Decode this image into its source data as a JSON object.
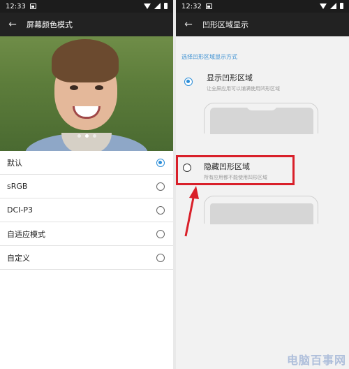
{
  "left": {
    "status": {
      "time": "12:33"
    },
    "appbar": {
      "back": "←",
      "title": "屏幕颜色模式"
    },
    "photo": {
      "slides": 3,
      "active_slide": 1
    },
    "options": [
      {
        "label": "默认",
        "checked": true
      },
      {
        "label": "sRGB",
        "checked": false
      },
      {
        "label": "DCI-P3",
        "checked": false
      },
      {
        "label": "自适应模式",
        "checked": false
      },
      {
        "label": "自定义",
        "checked": false
      }
    ]
  },
  "right": {
    "status": {
      "time": "12:32"
    },
    "appbar": {
      "back": "←",
      "title": "凹形区域显示"
    },
    "section_label": "选择凹形区域显示方式",
    "option_show": {
      "title": "显示凹形区域",
      "desc": "让全屏应用可以铺满使用凹形区域",
      "checked": true
    },
    "option_hide": {
      "title": "隐藏凹形区域",
      "desc": "所有应用都不能使用凹形区域",
      "checked": false
    }
  },
  "colors": {
    "accent": "#2c8ed8",
    "highlight": "#d9202a",
    "appbar": "#222222"
  },
  "watermark": "电脑百事网"
}
